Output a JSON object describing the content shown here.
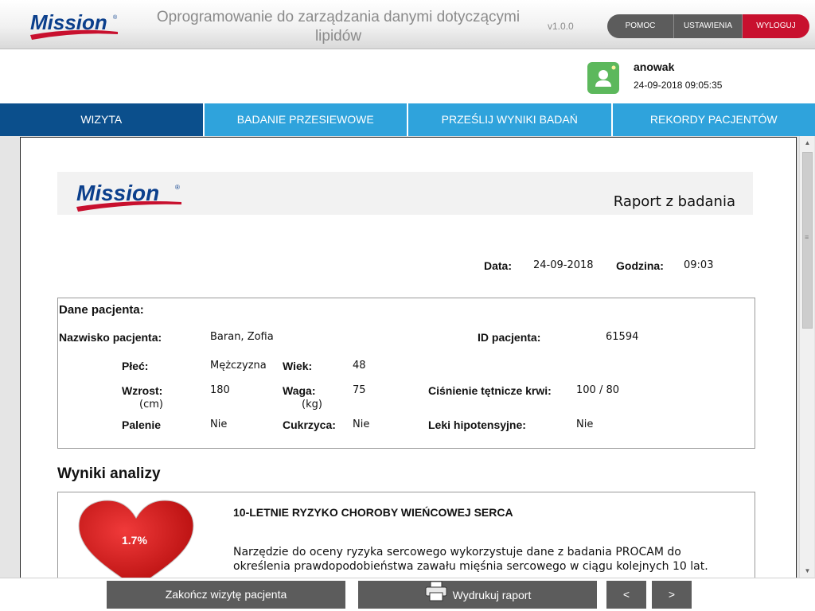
{
  "header": {
    "logo_text": "Mission",
    "title": "Oprogramowanie do zarządzania danymi dotyczącymi lipidów",
    "version": "v1.0.0",
    "nav": {
      "help": "POMOC",
      "settings": "USTAWIENIA",
      "logout": "WYLOGUJ"
    }
  },
  "user": {
    "name": "anowak",
    "datetime": "24-09-2018 09:05:35"
  },
  "tabs": [
    {
      "label": "WIZYTA",
      "active": true
    },
    {
      "label": "BADANIE PRZESIEWOWE",
      "active": false
    },
    {
      "label": "PRZEŚLIJ WYNIKI BADAŃ",
      "active": false
    },
    {
      "label": "REKORDY PACJENTÓW",
      "active": false
    }
  ],
  "report": {
    "logo_text": "Mission",
    "title": "Raport z badania",
    "date_label": "Data:",
    "date": "24-09-2018",
    "time_label": "Godzina:",
    "time": "09:03",
    "patient": {
      "heading": "Dane pacjenta:",
      "name_label": "Nazwisko pacjenta:",
      "name": "Baran, Zofia",
      "id_label": "ID pacjenta:",
      "id": "61594",
      "sex_label": "Płeć:",
      "sex": "Mężczyzna",
      "age_label": "Wiek:",
      "age": "48",
      "height_label": "Wzrost:",
      "height_unit": "(cm)",
      "height": "180",
      "weight_label": "Waga:",
      "weight_unit": "(kg)",
      "weight": "75",
      "bp_label": "Ciśnienie tętnicze krwi:",
      "bp": "100 / 80",
      "smoking_label": "Palenie",
      "smoking": "Nie",
      "diabetes_label": "Cukrzyca:",
      "diabetes": "Nie",
      "meds_label": "Leki hipotensyjne:",
      "meds": "Nie"
    },
    "results": {
      "heading": "Wyniki analizy",
      "risk_value": "1.7%",
      "risk_title": "10-LETNIE RYZYKO CHOROBY WIEŃCOWEJ SERCA",
      "risk_text": "Narzędzie do oceny ryzyka sercowego wykorzystuje dane z badania PROCAM do określenia prawdopodobieństwa zawału mięśnia sercowego w ciągu kolejnych 10 lat."
    }
  },
  "footer": {
    "end_visit": "Zakończ wizytę pacjenta",
    "print": "Wydrukuj raport",
    "prev": "<",
    "next": ">"
  },
  "colors": {
    "tab_active": "#0b4f8c",
    "tab": "#2fa3dc",
    "logout": "#c8102e",
    "button": "#5c5c5c",
    "brand_red": "#c8102e",
    "brand_blue": "#0b3f8c"
  }
}
